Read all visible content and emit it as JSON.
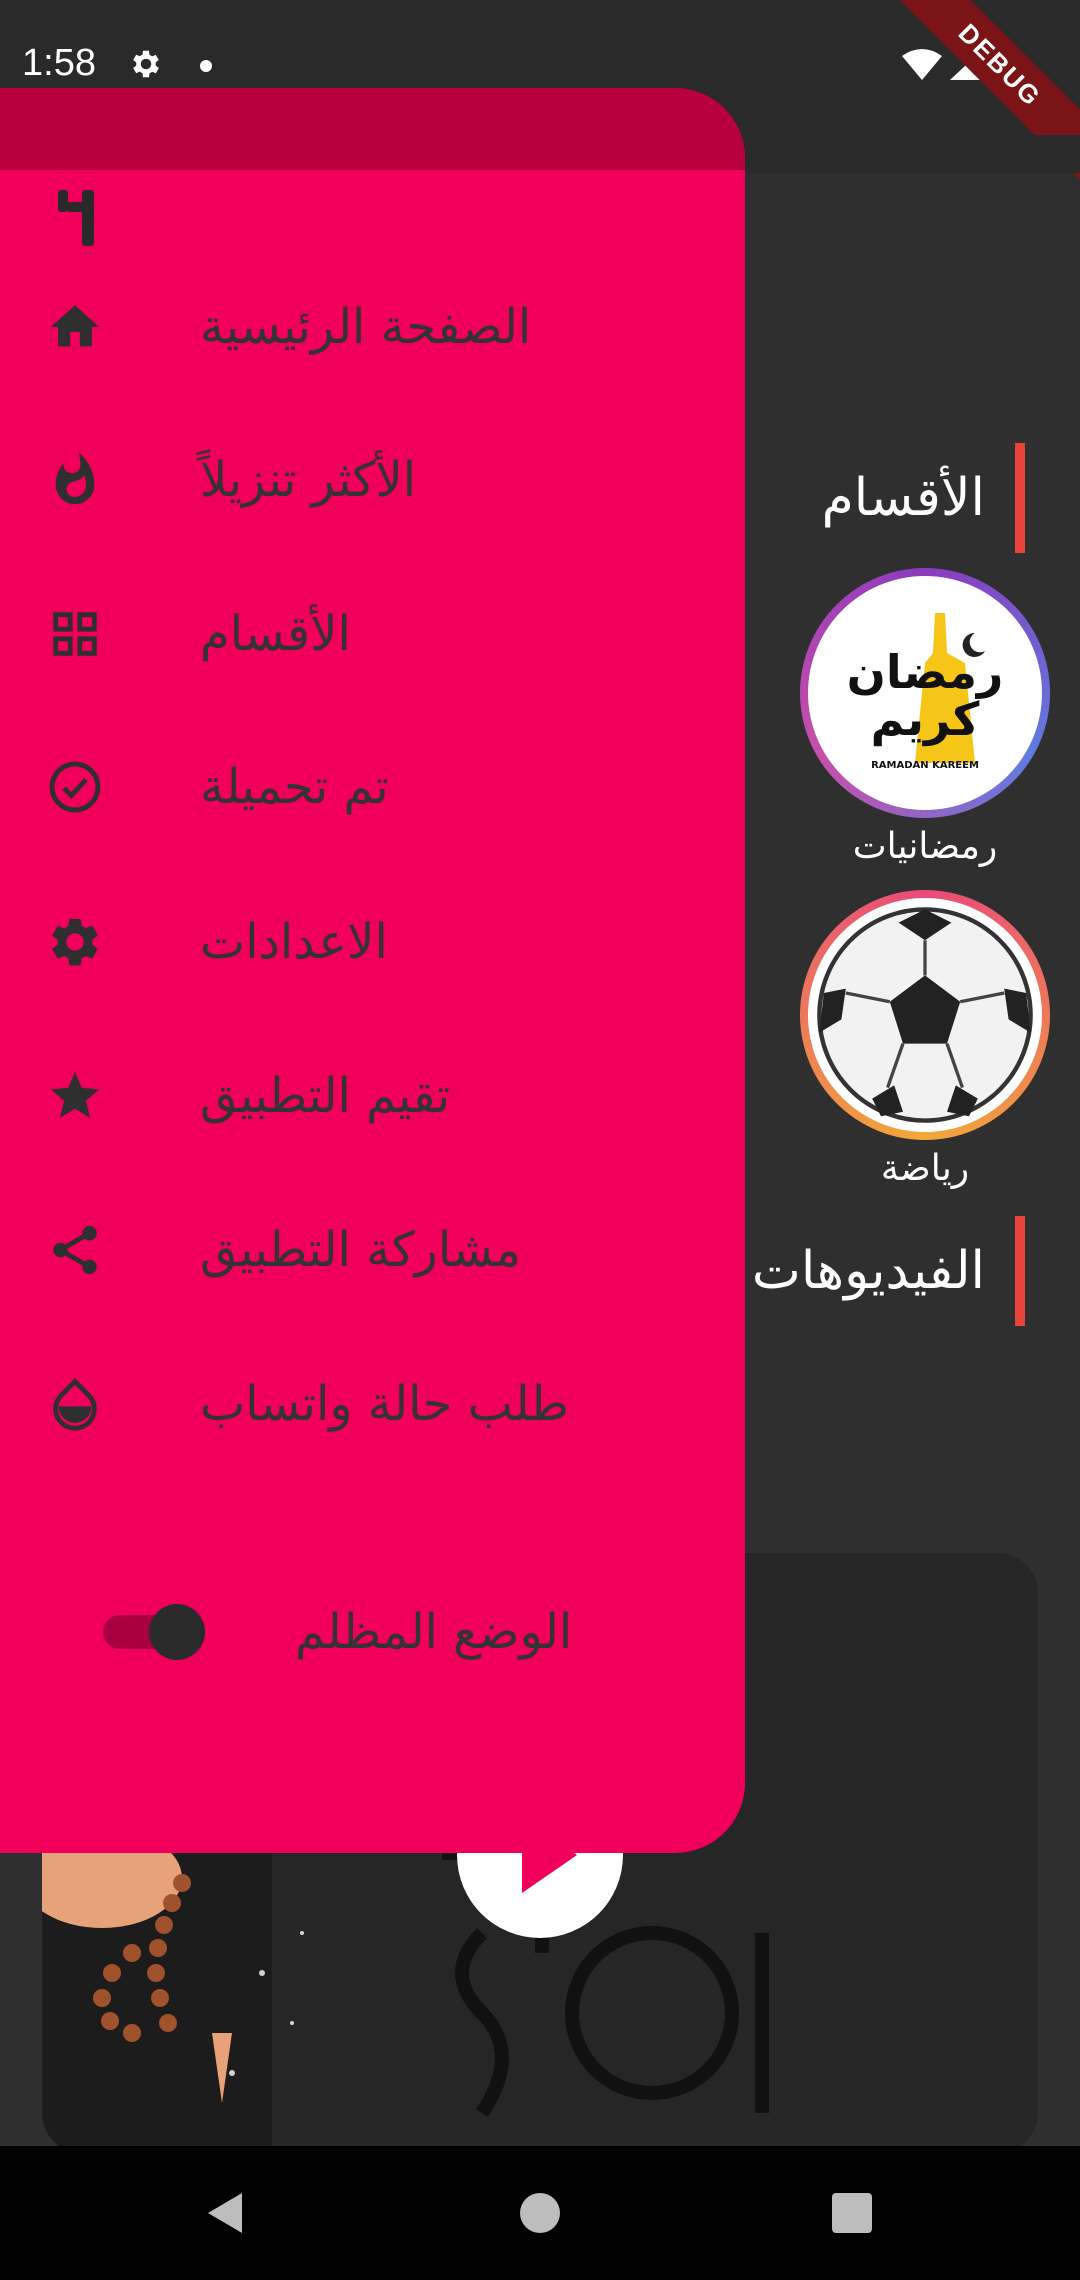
{
  "status_bar": {
    "time": "1:58",
    "debug_label": "DEBUG"
  },
  "background": {
    "sections_title": "الأقسام",
    "videos_title": "الفيديوهات",
    "categories": [
      {
        "label": "رمضانيات",
        "badge_text": "رمضان كريم",
        "badge_sub": "RAMADAN KAREEM"
      },
      {
        "label": "رياضة"
      }
    ]
  },
  "drawer": {
    "items": [
      {
        "label": "الصفحة الرئيسية",
        "icon": "home-icon"
      },
      {
        "label": "الأكثر تنزيلاً",
        "icon": "fire-icon"
      },
      {
        "label": "الأقسام",
        "icon": "grid-icon"
      },
      {
        "label": "تم تحميلة",
        "icon": "check-circle-icon"
      },
      {
        "label": "الاعدادات",
        "icon": "gear-icon"
      },
      {
        "label": "تقيم التطبيق",
        "icon": "star-icon"
      },
      {
        "label": "مشاركة التطبيق",
        "icon": "share-icon"
      },
      {
        "label": "طلب حالة واتساب",
        "icon": "drop-icon"
      }
    ],
    "dark_mode": {
      "label": "الوضع المظلم",
      "enabled": true
    }
  },
  "colors": {
    "drawer": "#f0005a",
    "drawer_header": "#b8003f",
    "accent_bar": "#e8443a"
  }
}
